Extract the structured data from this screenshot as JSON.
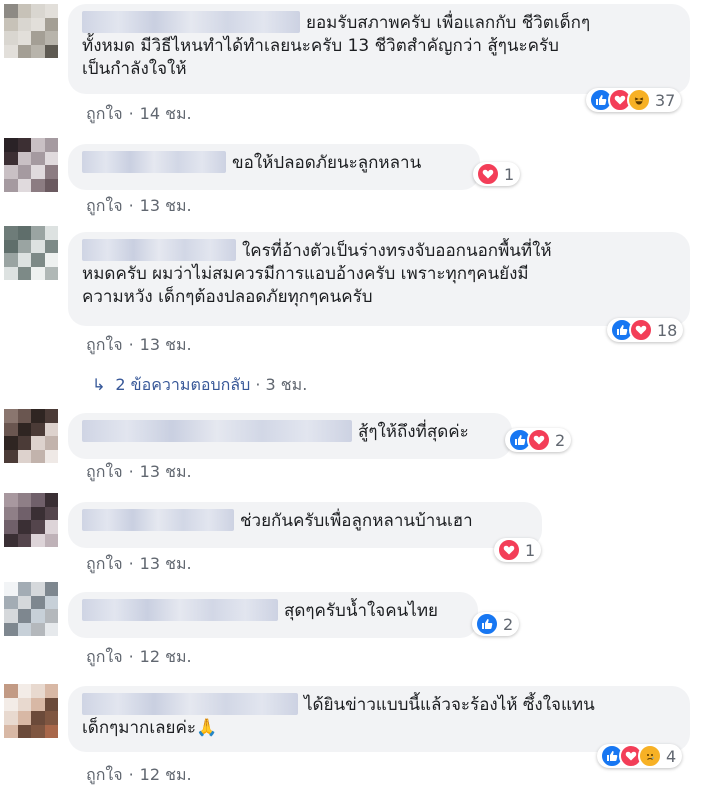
{
  "comments": [
    {
      "text_lines": [
        "ยอมรับสภาพครับ เพื่อแลกกับ ชีวิตเด็กๆ",
        "ทั้งหมด มีวิธีไหนทำได้ทำเลยนะครับ 13 ชีวิตสำคัญกว่า สู้ๆนะครับ",
        "เป็นกำลังใจให้"
      ],
      "like_label": "ถูกใจ",
      "time": "14 ชม.",
      "reactions": [
        "like",
        "love",
        "haha"
      ],
      "count": "37"
    },
    {
      "text_lines": [
        "ขอให้ปลอดภัยนะลูกหลาน"
      ],
      "like_label": "ถูกใจ",
      "time": "13 ชม.",
      "reactions": [
        "love"
      ],
      "count": "1"
    },
    {
      "text_lines": [
        "ใครที่อ้างตัวเป็นร่างทรงจับออกนอกพื้นที่ให้",
        "หมดครับ ผมว่าไม่สมควรมีการแอบอ้างครับ เพราะทุกๆคนยังมี",
        "ความหวัง เด็กๆต้องปลอดภัยทุกๆคนครับ"
      ],
      "like_label": "ถูกใจ",
      "time": "13 ชม.",
      "reactions": [
        "like",
        "love"
      ],
      "count": "18"
    },
    {
      "text_lines": [
        "สู้ๆให้ถึงที่สุดค่ะ"
      ],
      "like_label": "ถูกใจ",
      "time": "13 ชม.",
      "reactions": [
        "like",
        "love"
      ],
      "count": "2"
    },
    {
      "text_lines": [
        "ช่วยกันครับเพื่อลูกหลานบ้านเฮา"
      ],
      "like_label": "ถูกใจ",
      "time": "13 ชม.",
      "reactions": [
        "love"
      ],
      "count": "1"
    },
    {
      "text_lines": [
        "สุดๆครับน้ำใจคนไทย"
      ],
      "like_label": "ถูกใจ",
      "time": "12 ชม.",
      "reactions": [
        "like"
      ],
      "count": "2"
    },
    {
      "text_lines": [
        "ได้ยินข่าวแบบนี้แล้วจะร้องไห้ ซึ้งใจแทน",
        "เด็กๆมากเลยค่ะ🙏"
      ],
      "like_label": "ถูกใจ",
      "time": "12 ชม.",
      "reactions": [
        "like",
        "love",
        "sad"
      ],
      "count": "4"
    }
  ],
  "replies": {
    "label": "2 ข้อความตอบกลับ",
    "time": "3 ชม."
  },
  "colors": {
    "bubble": "#f2f3f5",
    "link": "#385898",
    "meta": "#616770",
    "like": "#1877f2",
    "love": "#f33e58",
    "haha": "#f7b125"
  }
}
